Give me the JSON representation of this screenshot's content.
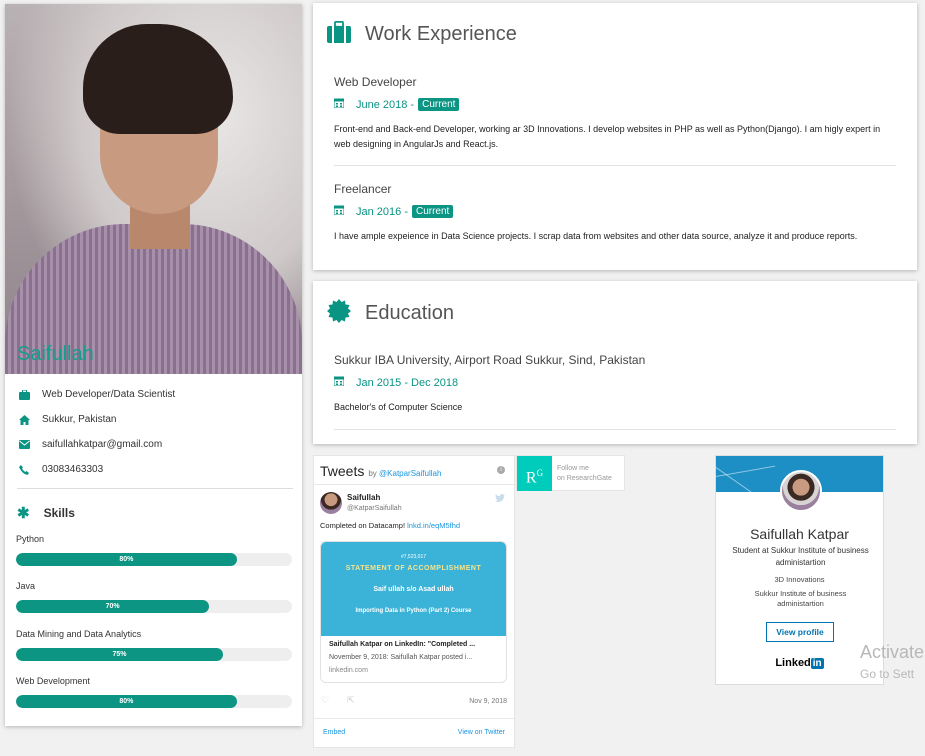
{
  "profile": {
    "name": "Saifullah",
    "info": [
      {
        "icon": "briefcase-icon",
        "text": "Web Developer/Data Scientist"
      },
      {
        "icon": "home-icon",
        "text": "Sukkur, Pakistan"
      },
      {
        "icon": "envelope-icon",
        "text": "saifullahkatpar@gmail.com"
      },
      {
        "icon": "phone-icon",
        "text": "03083463303"
      }
    ],
    "skills_title": "Skills",
    "skills": [
      {
        "name": "Python",
        "percent": 80,
        "label": "80%"
      },
      {
        "name": "Java",
        "percent": 70,
        "label": "70%"
      },
      {
        "name": "Data Mining and Data Analytics",
        "percent": 75,
        "label": "75%"
      },
      {
        "name": "Web Development",
        "percent": 80,
        "label": "80%"
      }
    ]
  },
  "work": {
    "title": "Work Experience",
    "jobs": [
      {
        "role": "Web Developer",
        "date": "June 2018 -",
        "badge": "Current",
        "desc": "Front-end and Back-end Developer, working ar 3D Innovations. I develop websites in PHP as well as Python(Django). I am higly expert in web designing in AngularJs and React.js."
      },
      {
        "role": "Freelancer",
        "date": "Jan 2016 -",
        "badge": "Current",
        "desc": "I have ample expeience in Data Science projects. I scrap data from websites and other data source, analyze it and produce reports."
      }
    ]
  },
  "education": {
    "title": "Education",
    "school": "Sukkur IBA University, Airport Road Sukkur, Sind, Pakistan",
    "date": "Jan 2015 - Dec 2018",
    "degree": "Bachelor's of Computer Science"
  },
  "tweets": {
    "title": "Tweets",
    "by_prefix": "by ",
    "by_handle": "@KatparSaifullah",
    "user": "Saifullah",
    "handle": "@KatparSaifullah",
    "text": "Completed on Datacamp! ",
    "link": "lnkd.in/eqM5fhd",
    "card": {
      "number": "#7,523,017",
      "statement": "STATEMENT OF ACCOMPLISHMENT",
      "name": "Saif ullah s/o Asad ullah",
      "course": "Importing Data in Python (Part 2) Course",
      "title": "Saifullah Katpar on LinkedIn: \"Completed ...",
      "desc": "November 9, 2018: Saifullah Katpar posted i...",
      "url": "linkedin.com"
    },
    "date": "Nov 9, 2018",
    "embed": "Embed",
    "view": "View on Twitter"
  },
  "researchgate": {
    "logo": "R",
    "logo_sup": "G",
    "line1": "Follow me",
    "line2": "on ResearchGate"
  },
  "linkedin": {
    "name": "Saifullah Katpar",
    "headline": "Student at Sukkur Institute of business administartion",
    "company": "3D Innovations",
    "school": "Sukkur Institute of business administartion",
    "button": "View profile",
    "brand": "Linked",
    "brand_in": "in"
  },
  "watermark": {
    "line1": "Activate",
    "line2": "Go to Sett"
  },
  "colors": {
    "accent": "#0d9584",
    "linkedin": "#0073b1",
    "twitter": "#1b95e0",
    "researchgate": "#00ccbb"
  }
}
